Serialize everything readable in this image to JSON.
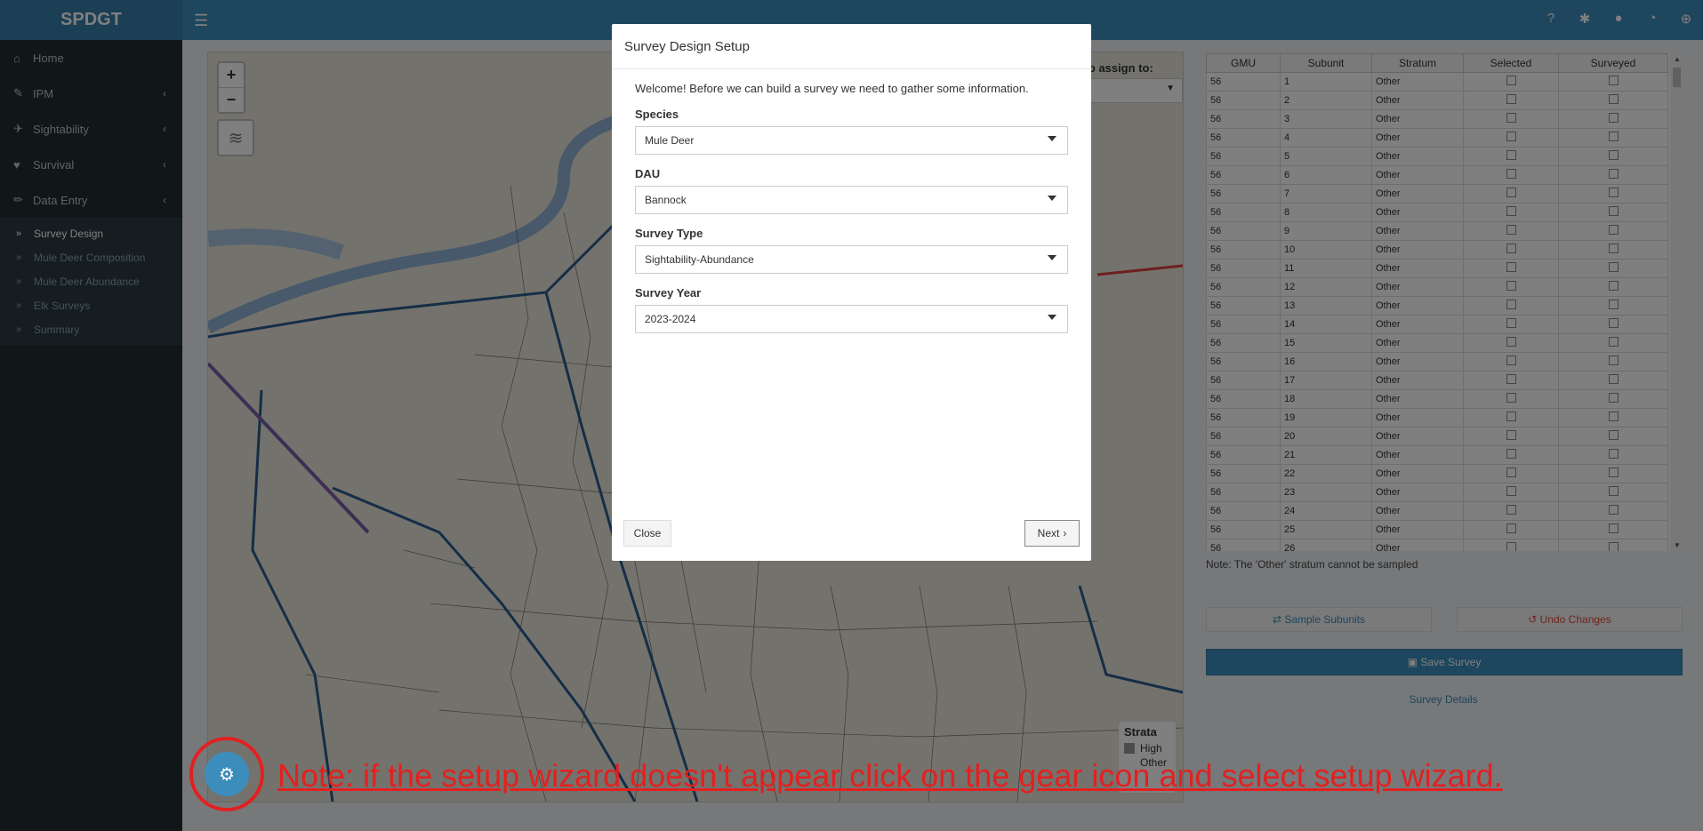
{
  "app": {
    "brand": "SPDGT",
    "colors": {
      "header": "#3c8dbc",
      "sidebar": "#222d32",
      "annotation": "#e32020"
    }
  },
  "sidebar": {
    "items": [
      {
        "label": "Home",
        "icon": "home-icon"
      },
      {
        "label": "IPM",
        "icon": "wand-icon"
      },
      {
        "label": "Sightability",
        "icon": "plane-icon"
      },
      {
        "label": "Survival",
        "icon": "heart-icon"
      },
      {
        "label": "Data Entry",
        "icon": "pencil-icon"
      }
    ],
    "sub_items": [
      {
        "label": "Survey Design",
        "active": true
      },
      {
        "label": "Mule Deer Composition"
      },
      {
        "label": "Mule Deer Abundance"
      },
      {
        "label": "Elk Surveys"
      },
      {
        "label": "Summary"
      }
    ]
  },
  "map": {
    "unit_assign_label": "nit to assign to:",
    "legend_title": "Strata",
    "legend_items": [
      "High",
      "Other"
    ]
  },
  "table": {
    "headers": [
      "GMU",
      "Subunit",
      "Stratum",
      "Selected",
      "Surveyed"
    ],
    "rows": [
      [
        "56",
        "1",
        "Other"
      ],
      [
        "56",
        "2",
        "Other"
      ],
      [
        "56",
        "3",
        "Other"
      ],
      [
        "56",
        "4",
        "Other"
      ],
      [
        "56",
        "5",
        "Other"
      ],
      [
        "56",
        "6",
        "Other"
      ],
      [
        "56",
        "7",
        "Other"
      ],
      [
        "56",
        "8",
        "Other"
      ],
      [
        "56",
        "9",
        "Other"
      ],
      [
        "56",
        "10",
        "Other"
      ],
      [
        "56",
        "11",
        "Other"
      ],
      [
        "56",
        "12",
        "Other"
      ],
      [
        "56",
        "13",
        "Other"
      ],
      [
        "56",
        "14",
        "Other"
      ],
      [
        "56",
        "15",
        "Other"
      ],
      [
        "56",
        "16",
        "Other"
      ],
      [
        "56",
        "17",
        "Other"
      ],
      [
        "56",
        "18",
        "Other"
      ],
      [
        "56",
        "19",
        "Other"
      ],
      [
        "56",
        "20",
        "Other"
      ],
      [
        "56",
        "21",
        "Other"
      ],
      [
        "56",
        "22",
        "Other"
      ],
      [
        "56",
        "23",
        "Other"
      ],
      [
        "56",
        "24",
        "Other"
      ],
      [
        "56",
        "25",
        "Other"
      ],
      [
        "56",
        "26",
        "Other"
      ]
    ]
  },
  "panel": {
    "note": "Note: The 'Other' stratum cannot be sampled",
    "sample_label": "Sample Subunits",
    "undo_label": "Undo Changes",
    "save_label": "Save Survey",
    "details_label": "Survey Details"
  },
  "modal": {
    "title": "Survey Design Setup",
    "intro": "Welcome! Before we can build a survey we need to gather some information.",
    "fields": [
      {
        "label": "Species",
        "value": "Mule Deer"
      },
      {
        "label": "DAU",
        "value": "Bannock"
      },
      {
        "label": "Survey Type",
        "value": "Sightability-Abundance"
      },
      {
        "label": "Survey Year",
        "value": "2023-2024"
      }
    ],
    "close_label": "Close",
    "next_label": "Next"
  },
  "annotation": {
    "text": "Note: if the setup wizard doesn't appear click on the gear icon and select setup wizard."
  }
}
